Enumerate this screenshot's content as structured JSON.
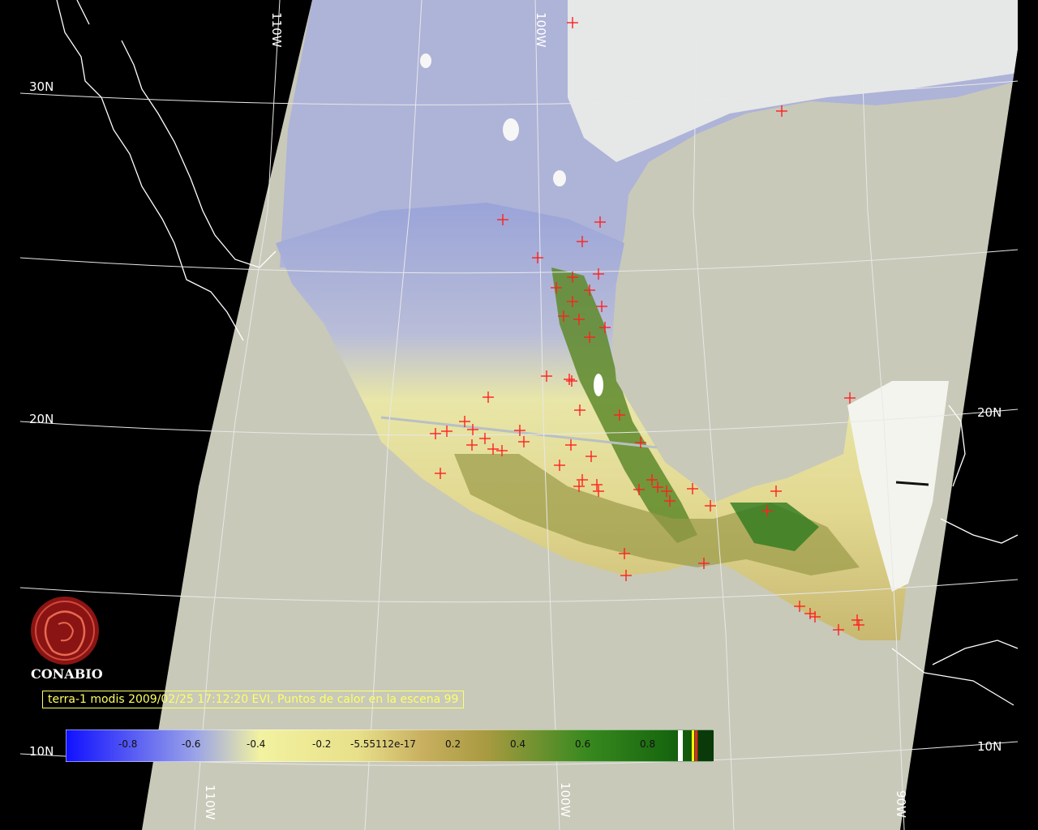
{
  "map": {
    "title": "terra-1 modis 2009/02/25 17:12:20 EVI, Puntos de calor en la escena 99",
    "brand": "CONABIO",
    "colors": {
      "background": "#000000",
      "no_data": "#c8c9b9",
      "grid": "#e8e8e8",
      "coast": "#ffffff",
      "hotspot": "#ff2020",
      "caption": "#ffff66"
    },
    "grid_labels": {
      "lon_110_top": "110W",
      "lon_100_top": "100W",
      "lat_30_left": "30N",
      "lat_20_left": "20N",
      "lat_20_right": "20N",
      "lat_10_left": "10N",
      "lat_10_right": "10N",
      "lon_110_bottom": "110W",
      "lon_100_bottom": "100W",
      "lon_90_bottom": "90W"
    },
    "colorbar": {
      "labels": [
        "-0.8",
        "-0.6",
        "-0.4",
        "-0.2",
        "-5.55112e-17",
        "0.2",
        "0.4",
        "0.6",
        "0.8"
      ],
      "stops": [
        "#1010ff",
        "#9aa3e8",
        "#f2f2a0",
        "#e8e08a",
        "#c8b060",
        "#a89a40",
        "#3a8a20",
        "#1a6a10",
        "#0a4a0a"
      ]
    }
  }
}
